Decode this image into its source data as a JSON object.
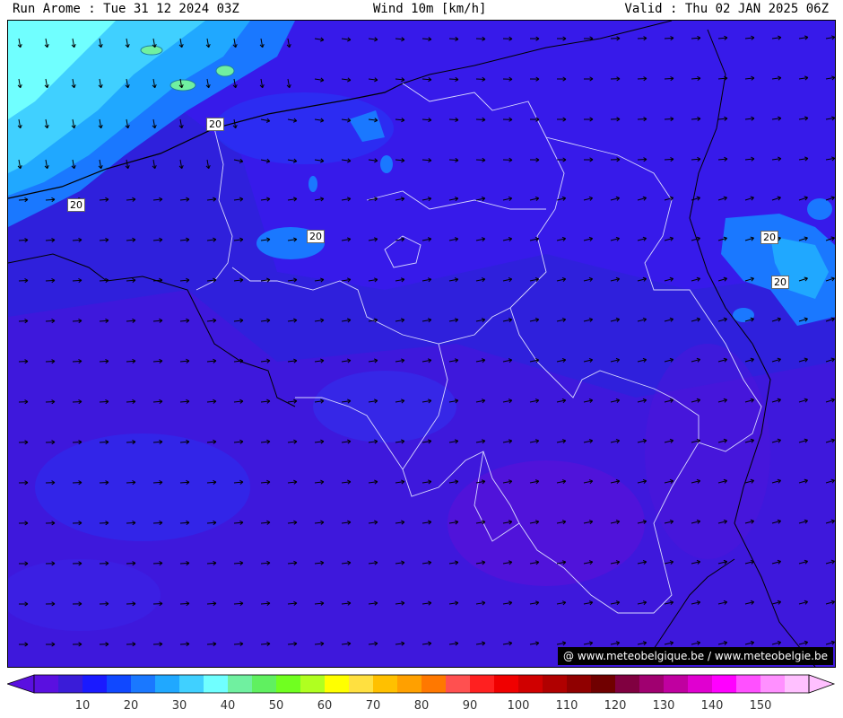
{
  "header": {
    "run_label": "Run Arome : Tue 31 12 2024 03Z",
    "product_label": "Wind 10m [km/h]",
    "valid_label": "Valid : Thu 02 JAN 2025 06Z"
  },
  "credit": "@ www.meteobelgique.be / www.meteobelgie.be",
  "contour_labels": [
    "20",
    "20",
    "20",
    "20",
    "20"
  ],
  "legend": {
    "colors": [
      "#5a10e0",
      "#3a1cd8",
      "#1a1aff",
      "#1048ff",
      "#1a78ff",
      "#20a8ff",
      "#40d0ff",
      "#70ffff",
      "#70f0a0",
      "#60f060",
      "#70ff20",
      "#b0ff20",
      "#ffff00",
      "#ffe040",
      "#ffc000",
      "#ffa000",
      "#ff7800",
      "#ff5050",
      "#ff2020",
      "#f00000",
      "#d00000",
      "#b00000",
      "#900000",
      "#700000",
      "#800040",
      "#a00070",
      "#c000a0",
      "#e000d0",
      "#ff00ff",
      "#ff50ff",
      "#ff90ff",
      "#ffc0ff"
    ],
    "tick_labels": [
      "10",
      "20",
      "30",
      "40",
      "50",
      "60",
      "70",
      "80",
      "90",
      "100",
      "110",
      "120",
      "130",
      "140",
      "150"
    ]
  }
}
